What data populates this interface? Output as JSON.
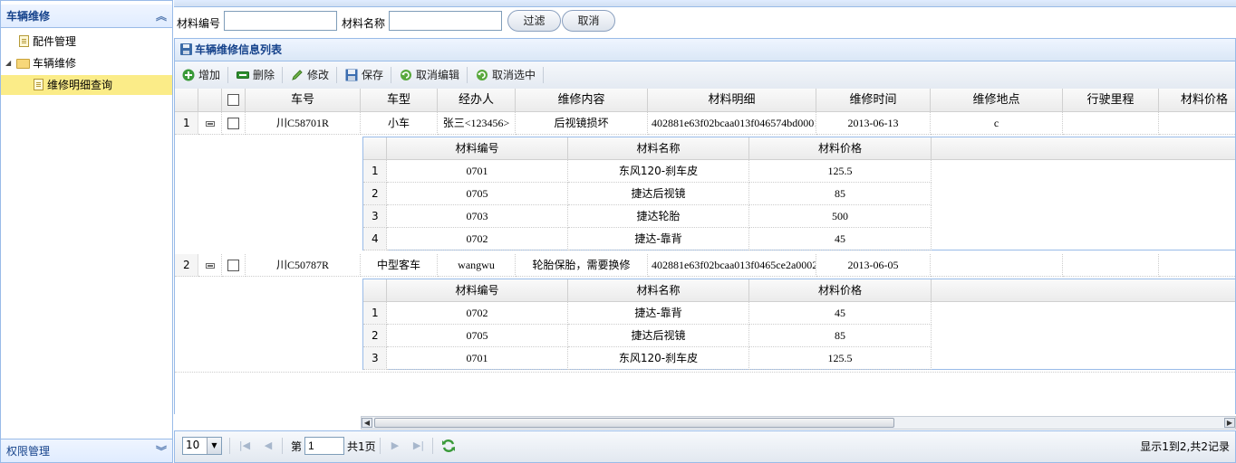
{
  "sidebar": {
    "header": "车辆维修",
    "items": [
      {
        "label": "配件管理"
      },
      {
        "label": "车辆维修"
      },
      {
        "label": "维修明细查询"
      }
    ],
    "footer": "权限管理"
  },
  "search": {
    "code_label": "材料编号",
    "name_label": "材料名称",
    "code_value": "",
    "name_value": "",
    "filter_button": "过滤",
    "cancel_button": "取消"
  },
  "grid": {
    "title": "车辆维修信息列表",
    "toolbar": [
      "增加",
      "删除",
      "修改",
      "保存",
      "取消编辑",
      "取消选中"
    ],
    "columns": [
      "车号",
      "车型",
      "经办人",
      "维修内容",
      "材料明细",
      "维修时间",
      "维修地点",
      "行驶里程",
      "材料价格"
    ],
    "rows": [
      {
        "num": "1",
        "plate": "川C58701R",
        "type": "小车",
        "handler": "张三<123456>",
        "content": "后视镜损坏",
        "detail": "402881e63f02bcaa013f046574bd0001",
        "date": "2013-06-13",
        "place": "c",
        "mileage": "",
        "price": "",
        "sub": [
          {
            "num": "1",
            "code": "0701",
            "name": "东风120-刹车皮",
            "price": "125.5"
          },
          {
            "num": "2",
            "code": "0705",
            "name": "捷达后视镜",
            "price": "85"
          },
          {
            "num": "3",
            "code": "0703",
            "name": "捷达轮胎",
            "price": "500"
          },
          {
            "num": "4",
            "code": "0702",
            "name": "捷达-靠背",
            "price": "45"
          }
        ]
      },
      {
        "num": "2",
        "plate": "川C50787R",
        "type": "中型客车",
        "handler": "wangwu",
        "content": "轮胎保胎，需要换修",
        "detail": "402881e63f02bcaa013f0465ce2a0002",
        "date": "2013-06-05",
        "place": "",
        "mileage": "",
        "price": "",
        "sub": [
          {
            "num": "1",
            "code": "0702",
            "name": "捷达-靠背",
            "price": "45"
          },
          {
            "num": "2",
            "code": "0705",
            "name": "捷达后视镜",
            "price": "85"
          },
          {
            "num": "3",
            "code": "0701",
            "name": "东风120-刹车皮",
            "price": "125.5"
          }
        ]
      }
    ],
    "sub_columns": [
      "材料编号",
      "材料名称",
      "材料价格"
    ]
  },
  "pager": {
    "page_size": "10",
    "page_prefix": "第",
    "page_value": "1",
    "page_suffix": "共1页",
    "summary": "显示1到2,共2记录"
  }
}
